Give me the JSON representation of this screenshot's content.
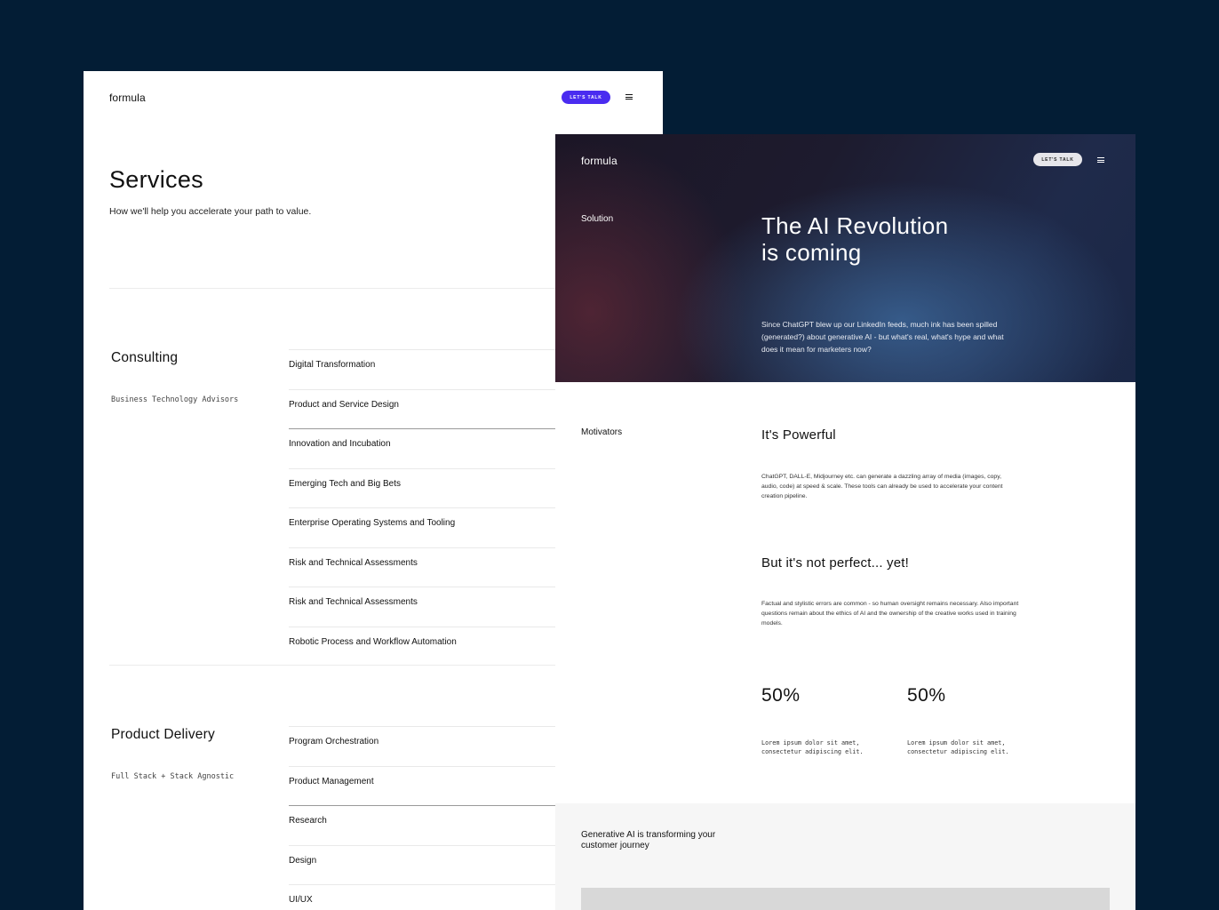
{
  "services_page": {
    "logo": "formula",
    "cta": "LET'S TALK",
    "title": "Services",
    "subtitle": "How we'll help you accelerate your path to value.",
    "sections": [
      {
        "title": "Consulting",
        "tag": "Business Technology Advisors",
        "items": [
          "Digital Transformation",
          "Product and Service Design",
          "Innovation and Incubation",
          "Emerging Tech and Big Bets",
          "Enterprise Operating Systems and Tooling",
          "Risk and Technical Assessments",
          "Risk and Technical Assessments",
          "Robotic Process and Workflow Automation"
        ]
      },
      {
        "title": "Product Delivery",
        "tag": "Full Stack + Stack Agnostic",
        "items": [
          "Program Orchestration",
          "Product Management",
          "Research",
          "Design",
          "UI/UX"
        ]
      }
    ]
  },
  "ai_page": {
    "logo": "formula",
    "cta": "LET'S TALK",
    "hero": {
      "label": "Solution",
      "title_line1": "The AI Revolution",
      "title_line2": "is coming",
      "body": "Since ChatGPT blew up our LinkedIn feeds, much ink has been spilled (generated?) about generative AI - but what's real, what's hype and what does it mean for marketers now?"
    },
    "motivators": {
      "label": "Motivators",
      "h1": "It's Powerful",
      "p1": "ChatGPT, DALL-E, Midjourney etc. can generate a dazzling array of media (images, copy, audio, code) at speed & scale. These tools can already be used to accelerate your content creation pipeline.",
      "h2": "But it's not perfect... yet!",
      "p2": "Factual and stylistic errors are common - so human oversight remains necessary. Also important questions remain about the ethics of AI and the ownership of the creative works used in training models."
    },
    "stats": [
      {
        "value": "50%",
        "desc": "Lorem ipsum dolor sit amet, consectetur adipiscing elit."
      },
      {
        "value": "50%",
        "desc": "Lorem ipsum dolor sit amet, consectetur adipiscing elit."
      }
    ],
    "band_text": "Generative AI is transforming your customer journey"
  },
  "colors": {
    "background": "#031d35",
    "cta_accent": "#4a2cf0"
  }
}
